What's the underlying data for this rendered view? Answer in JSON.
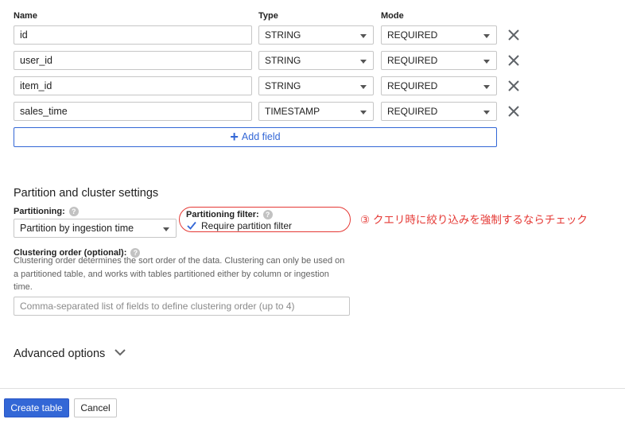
{
  "schema": {
    "headers": {
      "name": "Name",
      "type": "Type",
      "mode": "Mode"
    },
    "fields": [
      {
        "name": "id",
        "type": "STRING",
        "mode": "REQUIRED"
      },
      {
        "name": "user_id",
        "type": "STRING",
        "mode": "REQUIRED"
      },
      {
        "name": "item_id",
        "type": "STRING",
        "mode": "REQUIRED"
      },
      {
        "name": "sales_time",
        "type": "TIMESTAMP",
        "mode": "REQUIRED"
      }
    ],
    "add_field_label": "Add field"
  },
  "partition": {
    "section_title": "Partition and cluster settings",
    "partitioning_label": "Partitioning:",
    "partitioning_value": "Partition by ingestion time",
    "filter_label": "Partitioning filter:",
    "require_filter_label": "Require partition filter",
    "require_filter_checked": true,
    "clustering_label": "Clustering order (optional):",
    "clustering_help_line1": "Clustering order determines the sort order of the data. Clustering can only be used on",
    "clustering_help_line2": "a partitioned table, and works with tables partitioned either by column or ingestion",
    "clustering_help_line3": "time.",
    "clustering_placeholder": "Comma-separated list of fields to define clustering order (up to 4)"
  },
  "annotation": {
    "text": "③ クエリ時に絞り込みを強制するならチェック",
    "color": "#e53935"
  },
  "advanced": {
    "label": "Advanced options"
  },
  "footer": {
    "create_label": "Create table",
    "cancel_label": "Cancel"
  },
  "colors": {
    "accent": "#3367d6",
    "annotation": "#e53935"
  }
}
